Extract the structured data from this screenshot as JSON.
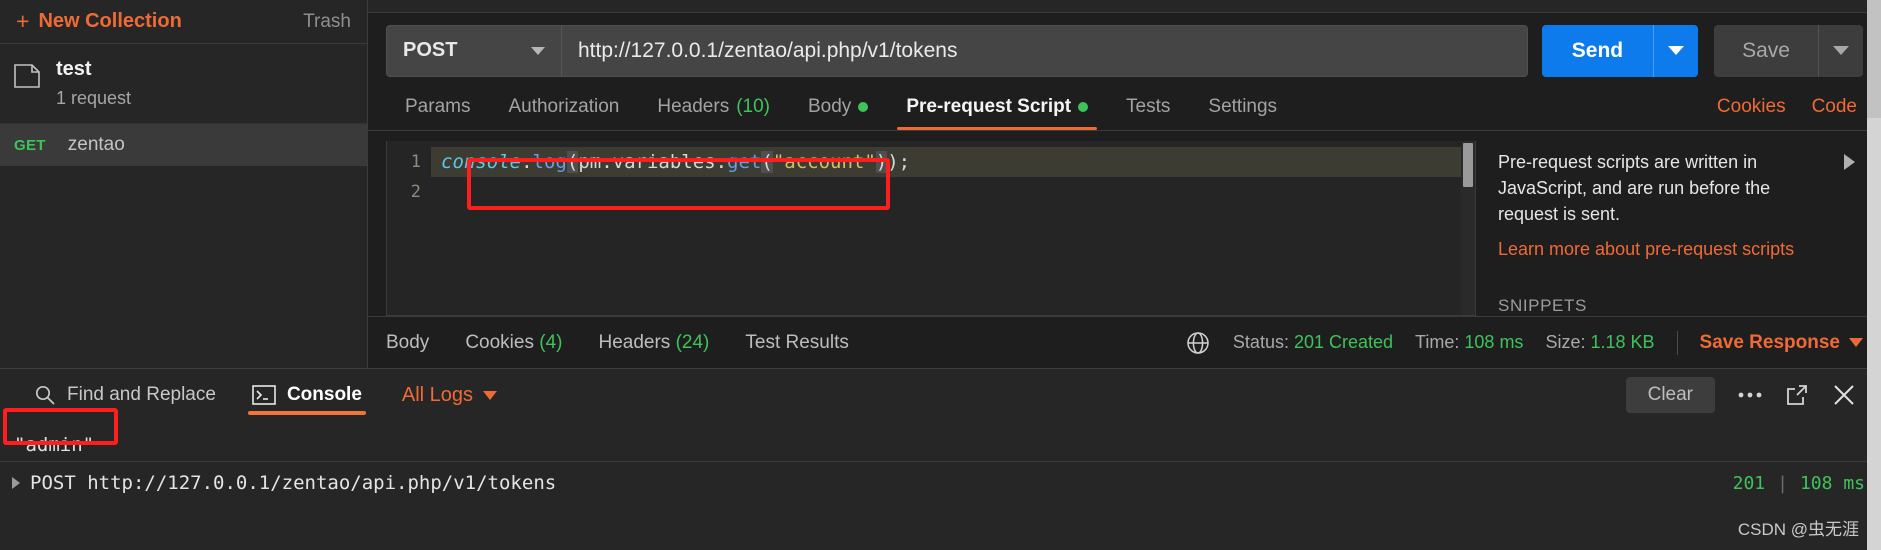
{
  "sidebar": {
    "new_collection_label": "New Collection",
    "trash_label": "Trash",
    "collection": {
      "name": "test",
      "subtitle": "1 request"
    },
    "request": {
      "method": "GET",
      "name": "zentao"
    }
  },
  "request": {
    "method": "POST",
    "url": "http://127.0.0.1/zentao/api.php/v1/tokens",
    "send_label": "Send",
    "save_label": "Save",
    "tabs": [
      {
        "label": "Params",
        "count": "",
        "dot": false,
        "active": false
      },
      {
        "label": "Authorization",
        "count": "",
        "dot": false,
        "active": false
      },
      {
        "label": "Headers",
        "count": "(10)",
        "dot": false,
        "active": false
      },
      {
        "label": "Body",
        "count": "",
        "dot": true,
        "active": false
      },
      {
        "label": "Pre-request Script",
        "count": "",
        "dot": true,
        "active": true
      },
      {
        "label": "Tests",
        "count": "",
        "dot": false,
        "active": false
      },
      {
        "label": "Settings",
        "count": "",
        "dot": false,
        "active": false
      }
    ],
    "cookies_link": "Cookies",
    "code_link": "Code"
  },
  "editor": {
    "line_numbers": [
      "1",
      "2"
    ],
    "code": {
      "object": "console",
      "dot1": ".",
      "fn1": "log",
      "open1": "(",
      "inner": "pm.variables.",
      "fn2": "get",
      "open2": "(",
      "string": "\"account\"",
      "close2": ")",
      "close1": ")",
      "semicolon": ";"
    },
    "full_line": "console.log(pm.variables.get(\"account\"));"
  },
  "helper": {
    "description": "Pre-request scripts are written in JavaScript, and are run before the request is sent.",
    "link": "Learn more about pre-request scripts",
    "snippets_header": "SNIPPETS"
  },
  "response": {
    "tabs": [
      {
        "label": "Body",
        "count": ""
      },
      {
        "label": "Cookies",
        "count": "(4)"
      },
      {
        "label": "Headers",
        "count": "(24)"
      },
      {
        "label": "Test Results",
        "count": ""
      }
    ],
    "status_label": "Status:",
    "status_value": "201 Created",
    "time_label": "Time:",
    "time_value": "108 ms",
    "size_label": "Size:",
    "size_value": "1.18 KB",
    "save_response_label": "Save Response"
  },
  "console": {
    "find_replace_label": "Find and Replace",
    "console_label": "Console",
    "all_logs_label": "All Logs",
    "clear_label": "Clear",
    "output_line": "\"admin\"",
    "log_entry": {
      "text": "POST http://127.0.0.1/zentao/api.php/v1/tokens",
      "status": "201",
      "separator": "|",
      "time": "108 ms"
    }
  },
  "watermark": "CSDN @虫无涯",
  "colors": {
    "accent_orange": "#f06a35",
    "send_blue": "#0d7bec",
    "success_green": "#3ec35b",
    "annotation_red": "#ff1e1e"
  }
}
